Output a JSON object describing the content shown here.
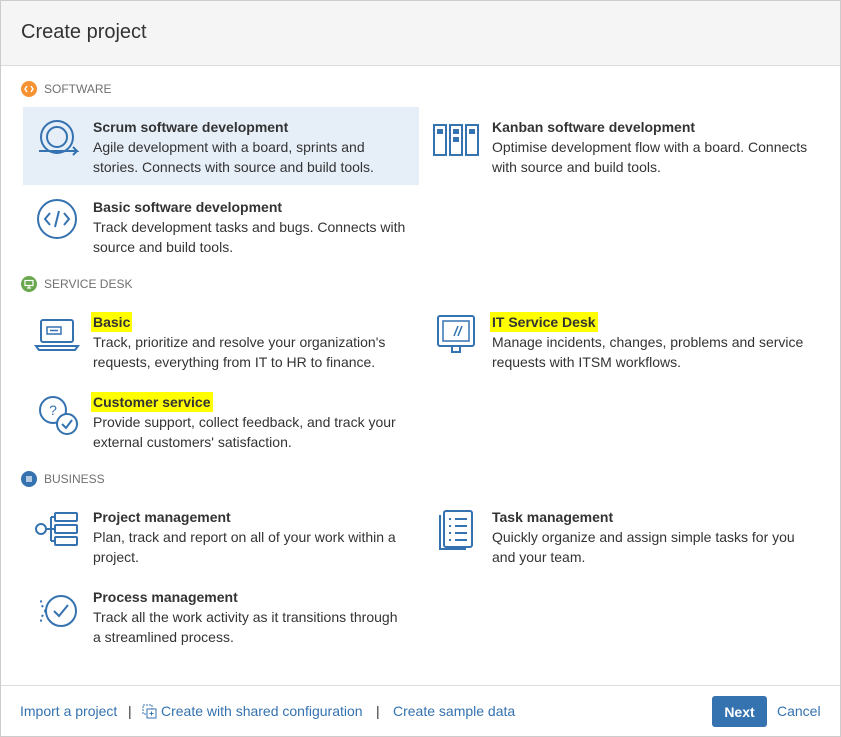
{
  "dialog": {
    "title": "Create project"
  },
  "sections": {
    "software": {
      "label": "SOFTWARE",
      "badge_color": "#f79232",
      "icon": "code-icon"
    },
    "service_desk": {
      "label": "SERVICE DESK",
      "badge_color": "#6aa84f",
      "icon": "monitor-icon"
    },
    "business": {
      "label": "BUSINESS",
      "badge_color": "#3572b0",
      "icon": "list-icon"
    }
  },
  "templates": {
    "scrum": {
      "title": "Scrum software development",
      "desc1": "Agile development with a board, sprints and",
      "desc2": "stories. Connects with source and build tools.",
      "selected": true,
      "icon": "scrum-cycle-icon"
    },
    "kanban": {
      "title": "Kanban software development",
      "desc1": "Optimise development flow with a board. Connects",
      "desc2": "with source and build tools.",
      "icon": "kanban-board-icon"
    },
    "basic_software": {
      "title": "Basic software development",
      "desc1": "Track development tasks and bugs. Connects with",
      "desc2": "source and build tools.",
      "icon": "code-brackets-icon"
    },
    "sd_basic": {
      "title": "Basic",
      "desc1": "Track, prioritize and resolve your organization's",
      "desc2": "requests, everything from IT to HR to finance.",
      "highlighted": true,
      "icon": "laptop-icon"
    },
    "it_service_desk": {
      "title": "IT Service Desk",
      "desc1": "Manage incidents, changes, problems and service",
      "desc2": "requests with ITSM workflows.",
      "highlighted": true,
      "icon": "desktop-monitor-icon"
    },
    "customer_service": {
      "title": "Customer service",
      "desc1": "Provide support, collect feedback, and track your",
      "desc2": "external customers' satisfaction.",
      "highlighted": true,
      "icon": "chat-bubbles-icon"
    },
    "project_mgmt": {
      "title": "Project management",
      "desc1": "Plan, track and report on all of your work within a",
      "desc2": "project.",
      "icon": "project-tree-icon"
    },
    "task_mgmt": {
      "title": "Task management",
      "desc1": "Quickly organize and assign simple tasks for you",
      "desc2": "and your team.",
      "icon": "checklist-icon"
    },
    "process_mgmt": {
      "title": "Process management",
      "desc1": "Track all the work activity as it transitions through",
      "desc2": "a streamlined process.",
      "icon": "process-check-icon"
    }
  },
  "footer": {
    "import_label": "Import a project",
    "separator": "|",
    "shared_config_label": "Create with shared configuration",
    "sample_data_label": "Create sample data",
    "next_label": "Next",
    "cancel_label": "Cancel"
  },
  "colors": {
    "accent": "#3572b0",
    "highlight": "#ffff00",
    "selected_bg": "#e6eef8",
    "icon_stroke": "#3572b0"
  }
}
